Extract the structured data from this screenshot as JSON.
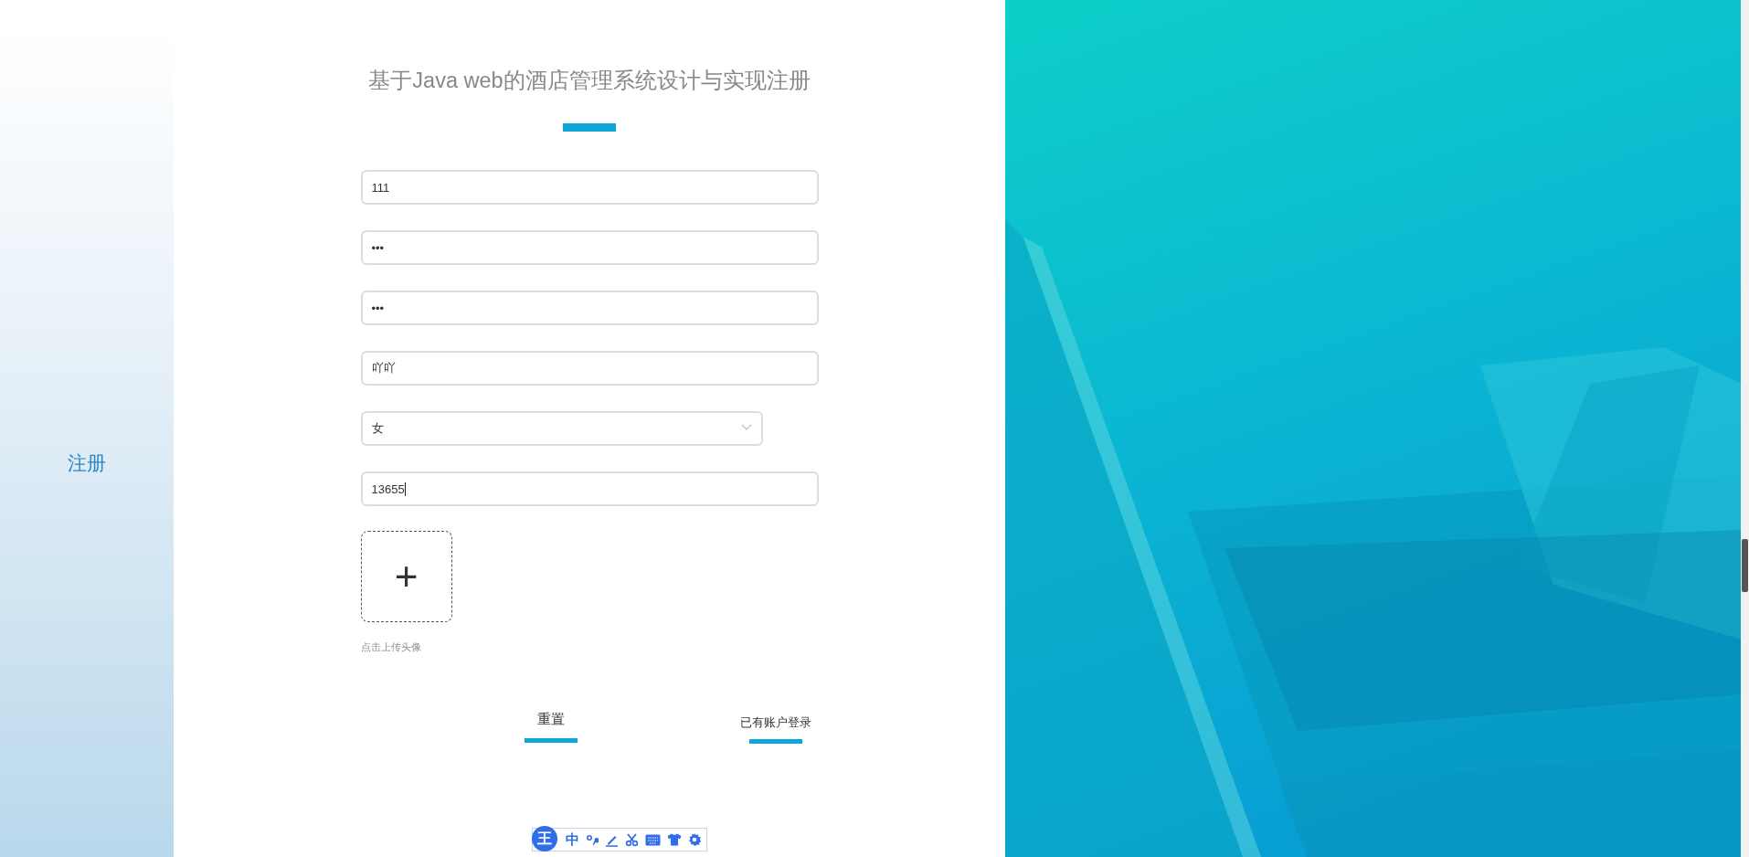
{
  "sidebar": {
    "label": "注册"
  },
  "form": {
    "title": "基于Java web的酒店管理系统设计与实现注册",
    "fields": [
      {
        "kind": "text",
        "value": "111",
        "focused": false
      },
      {
        "kind": "password",
        "value": "•••",
        "focused": false
      },
      {
        "kind": "password",
        "value": "•••",
        "focused": false
      },
      {
        "kind": "text",
        "value": "吖吖",
        "focused": false
      },
      {
        "kind": "select",
        "value": "女",
        "focused": false
      },
      {
        "kind": "text",
        "value": "13655",
        "focused": true
      }
    ],
    "upload": {
      "icon": "+",
      "hint": "点击上传头像"
    },
    "buttons": [
      {
        "kind": "reset",
        "label": "重置"
      },
      {
        "kind": "link",
        "label": "已有账户登录"
      }
    ]
  },
  "ime_toolbar": {
    "logo": "王",
    "mode": "中"
  }
}
